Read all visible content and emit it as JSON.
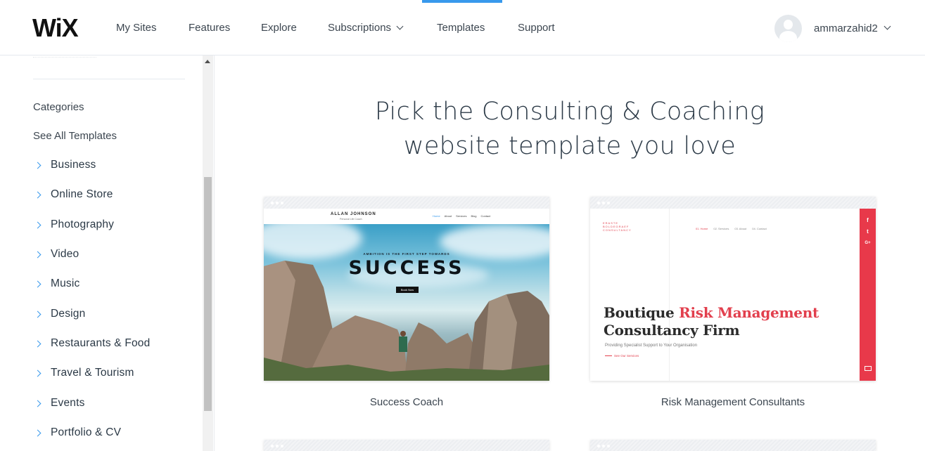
{
  "header": {
    "logo": "WiX",
    "nav": [
      {
        "label": "My Sites"
      },
      {
        "label": "Features"
      },
      {
        "label": "Explore"
      },
      {
        "label": "Subscriptions"
      },
      {
        "label": "Templates"
      },
      {
        "label": "Support"
      }
    ],
    "active_nav": "Templates",
    "user": {
      "name": "ammarzahid2",
      "avatar_icon": "user-avatar-icon"
    },
    "accent_color": "#3899ec"
  },
  "sidebar": {
    "categories_heading": "Categories",
    "see_all": "See All Templates",
    "items": [
      {
        "label": "Business"
      },
      {
        "label": "Online Store"
      },
      {
        "label": "Photography"
      },
      {
        "label": "Video"
      },
      {
        "label": "Music"
      },
      {
        "label": "Design"
      },
      {
        "label": "Restaurants & Food"
      },
      {
        "label": "Travel & Tourism"
      },
      {
        "label": "Events"
      },
      {
        "label": "Portfolio & CV"
      }
    ],
    "arrow_icon": "chevron-right-icon",
    "arrow_color": "#3899ec"
  },
  "main": {
    "title_line1": "Pick the Consulting & Coaching",
    "title_line2": "website template you love",
    "templates": [
      {
        "name": "Success Coach",
        "preview": {
          "brand": "ALLAN JOHNSON",
          "brand_sub": "Personal Life Coach",
          "menu": [
            "Home",
            "About",
            "Services",
            "Blog",
            "Contact"
          ],
          "tagline": "AMBITION IS THE FIRST STEP TOWARDS",
          "headline": "SUCCESS",
          "button": "Book Now"
        }
      },
      {
        "name": "Risk Management Consultants",
        "preview": {
          "logo_lines": [
            "ERASTE",
            "BOLDEGRAEF",
            "CONSULTANCY"
          ],
          "menu": [
            "01. Home",
            "02. Services",
            "03. About",
            "04. Contact"
          ],
          "headline_part1": "Boutique ",
          "headline_red": "Risk Management",
          "headline_line2": "Consultancy Firm",
          "subline": "Providing Specialist Support to Your Organisation",
          "link": "See Our Services",
          "social": [
            "f",
            "t",
            "G+"
          ],
          "brand_color": "#e23f4d"
        }
      }
    ]
  }
}
